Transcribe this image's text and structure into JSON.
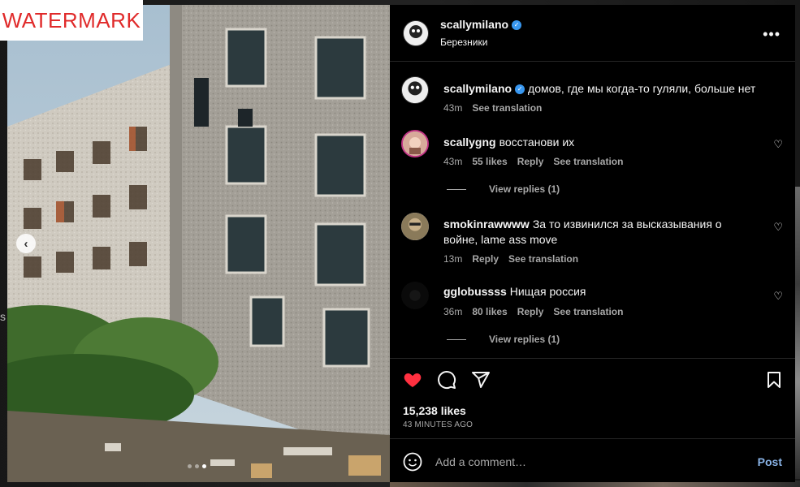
{
  "watermark": "WATERMARK",
  "stray_text": "s",
  "post": {
    "username": "scallymilano",
    "location": "Березники",
    "more_label": "•••"
  },
  "carousel": {
    "prev_label": "‹",
    "slide_count": 3,
    "active_slide": 3
  },
  "comments": [
    {
      "username": "scallymilano",
      "verified": true,
      "text": "домов, где мы когда-то гуляли, больше нет",
      "time": "43m",
      "likes": "",
      "reply": "",
      "translation": "See translation",
      "replies": ""
    },
    {
      "username": "scallygng",
      "verified": false,
      "text": "восстанови их",
      "time": "43m",
      "likes": "55 likes",
      "reply": "Reply",
      "translation": "See translation",
      "replies": "View replies (1)"
    },
    {
      "username": "smokinrawwww",
      "verified": false,
      "text": "За то извинился за высказывания о войне, lame ass move",
      "time": "13m",
      "likes": "",
      "reply": "Reply",
      "translation": "See translation",
      "replies": ""
    },
    {
      "username": "gglobussss",
      "verified": false,
      "text": "Нищая россия",
      "time": "36m",
      "likes": "80 likes",
      "reply": "Reply",
      "translation": "See translation",
      "replies": "View replies (1)"
    }
  ],
  "actions": {
    "likes": "15,238 likes",
    "time": "43 MINUTES AGO",
    "comment_placeholder": "Add a comment…",
    "post_label": "Post"
  },
  "colors": {
    "accent": "#3897f0",
    "like": "#ff3040",
    "post": "#8ab4e8"
  },
  "icons": [
    "heart-filled-icon",
    "comment-icon",
    "share-icon",
    "bookmark-icon",
    "emoji-icon",
    "more-icon",
    "verified-icon",
    "chevron-left-icon"
  ]
}
